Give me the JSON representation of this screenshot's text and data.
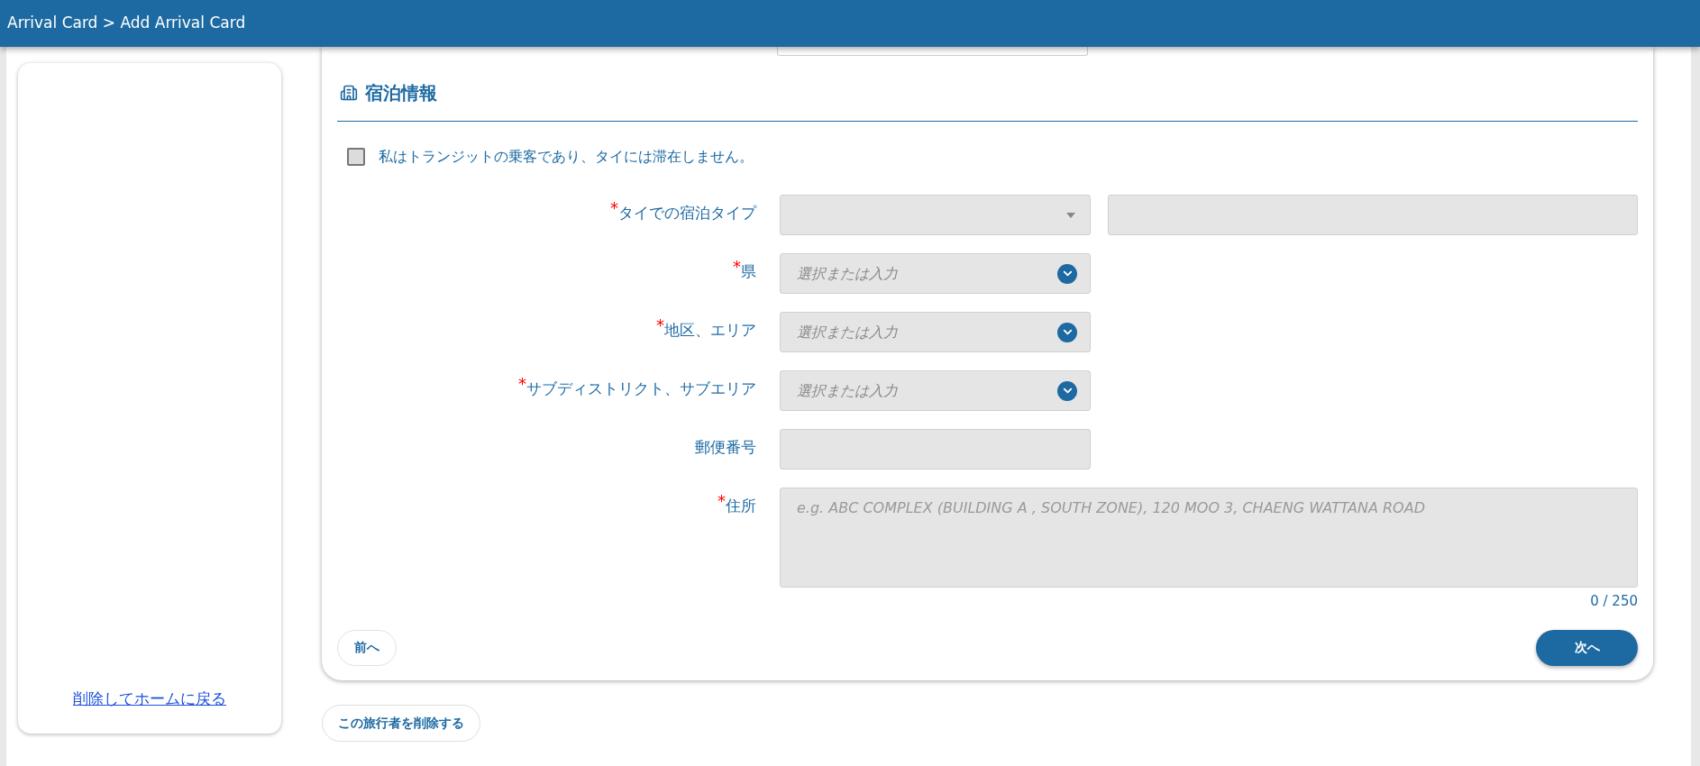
{
  "header": {
    "breadcrumb": "Arrival Card > Add Arrival Card"
  },
  "sidebar": {
    "link": "削除してホームに戻る"
  },
  "section": {
    "title": "宿泊情報"
  },
  "transit_checkbox": {
    "label": "私はトランジットの乗客であり、タイには滞在しません。",
    "checked": false
  },
  "fields": [
    {
      "kind": "select_with_text",
      "label": "タイでの宿泊タイプ",
      "mark": "*"
    },
    {
      "kind": "combo",
      "label": "県",
      "mark": "*",
      "placeholder": "選択または入力"
    },
    {
      "kind": "combo",
      "label": "地区、エリア",
      "mark": "*",
      "placeholder": "選択または入力"
    },
    {
      "kind": "combo",
      "label": "サブディストリクト、サブエリア",
      "mark": "*",
      "placeholder": "選択または入力"
    },
    {
      "kind": "text",
      "label": "郵便番号"
    },
    {
      "kind": "textarea",
      "label": "住所",
      "mark": "*",
      "placeholder": "e.g. ABC COMPLEX (BUILDING A , SOUTH ZONE), 120 MOO 3, CHAENG WATTANA ROAD",
      "counter": "0 / 250"
    }
  ],
  "buttons": {
    "prev": "前へ",
    "next": "次へ"
  },
  "delete_traveler": "この旅行者を削除する"
}
